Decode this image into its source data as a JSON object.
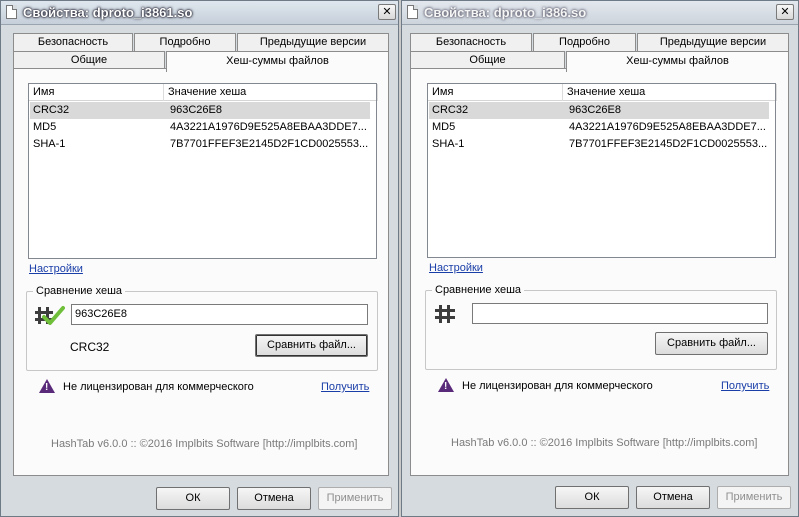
{
  "windows": [
    {
      "title": "Свойства: dproto_i3861.so",
      "tabs_back": [
        "Безопасность",
        "Подробно",
        "Предыдущие версии"
      ],
      "tabs_front": [
        "Общие",
        "Хеш-суммы файлов"
      ],
      "columns": [
        "Имя",
        "Значение хеша"
      ],
      "rows": [
        {
          "name": "CRC32",
          "value": "963C26E8"
        },
        {
          "name": "MD5",
          "value": "4A3221A1976D9E525A8EBAA3DDE7..."
        },
        {
          "name": "SHA-1",
          "value": "7B7701FFEF3E2145D2F1CD0025553..."
        }
      ],
      "settings_link": "Настройки",
      "compare_group": "Сравнение хеша",
      "compare_value": "963C26E8",
      "match_label": "CRC32",
      "compare_file_button": "Сравнить файл...",
      "license_text": "Не лицензирован для коммерческого",
      "get_link": "Получить",
      "footer": "HashTab v6.0.0 :: ©2016 Implbits Software [http://implbits.com]",
      "ok": "ОК",
      "cancel": "Отмена",
      "apply": "Применить"
    },
    {
      "title": "Свойства: dproto_i386.so",
      "tabs_back": [
        "Безопасность",
        "Подробно",
        "Предыдущие версии"
      ],
      "tabs_front": [
        "Общие",
        "Хеш-суммы файлов"
      ],
      "columns": [
        "Имя",
        "Значение хеша"
      ],
      "rows": [
        {
          "name": "CRC32",
          "value": "963C26E8"
        },
        {
          "name": "MD5",
          "value": "4A3221A1976D9E525A8EBAA3DDE7..."
        },
        {
          "name": "SHA-1",
          "value": "7B7701FFEF3E2145D2F1CD0025553..."
        }
      ],
      "settings_link": "Настройки",
      "compare_group": "Сравнение хеша",
      "compare_value": "",
      "compare_file_button": "Сравнить файл...",
      "license_text": "Не лицензирован для коммерческого",
      "get_link": "Получить",
      "footer": "HashTab v6.0.0 :: ©2016 Implbits Software [http://implbits.com]",
      "ok": "ОК",
      "cancel": "Отмена",
      "apply": "Применить"
    }
  ],
  "icons": {
    "window": "document-icon",
    "close": "close-icon",
    "match": "hash-match-check-icon",
    "hash": "hash-icon",
    "warning": "warning-icon"
  },
  "colors": {
    "link": "#1a3ea8",
    "match_check": "#6fbf3a",
    "warning": "#5a2a7a"
  }
}
